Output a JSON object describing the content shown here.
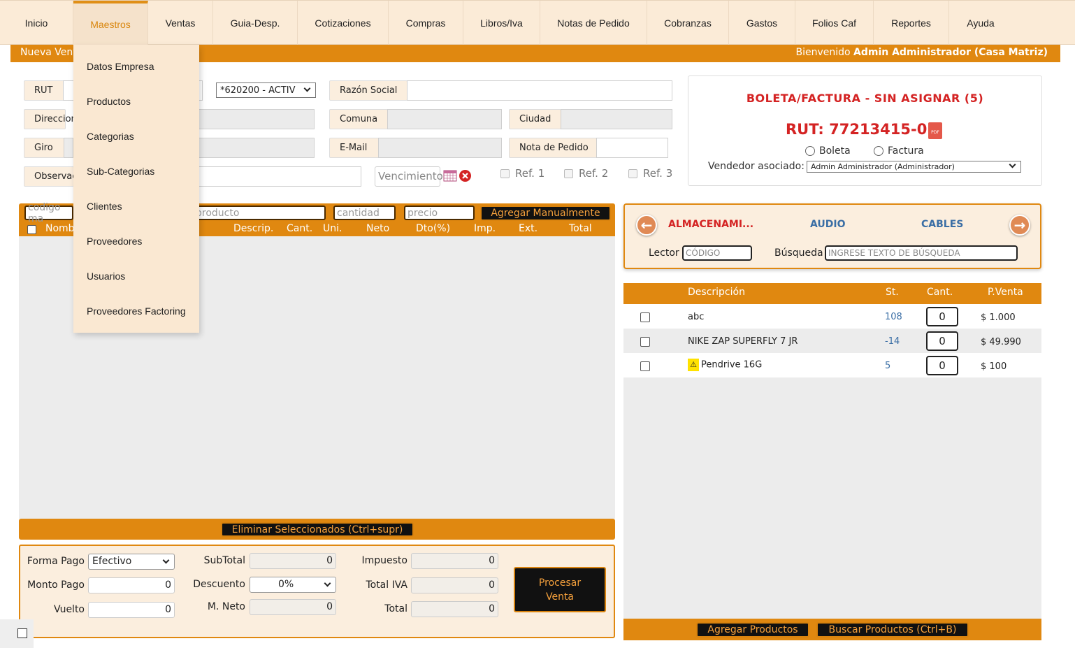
{
  "nav": {
    "items": [
      "Inicio",
      "Maestros",
      "Ventas",
      "Guia-Desp.",
      "Cotizaciones",
      "Compras",
      "Libros/Iva",
      "Notas de Pedido",
      "Cobranzas",
      "Gastos",
      "Folios Caf",
      "Reportes",
      "Ayuda"
    ],
    "active": "Maestros"
  },
  "welcome": {
    "left": "Nueva Vent",
    "prefix": "Bienvenido ",
    "user": "Admin Administrador (Casa Matriz)"
  },
  "dropdown": {
    "items": [
      "Datos Empresa",
      "Productos",
      "Categorias",
      "Sub-Categorias",
      "Clientes",
      "Proveedores",
      "Usuarios",
      "Proveedores Factoring"
    ]
  },
  "form": {
    "rut_label": "RUT",
    "activity_select": "*620200 - ACTIV",
    "razon_label": "Razón Social",
    "direccion_label": "Direccion",
    "comuna_label": "Comuna",
    "ciudad_label": "Ciudad",
    "giro_label": "Giro",
    "email_label": "E-Mail",
    "nota_label": "Nota de Pedido",
    "observ_label": "Observac",
    "vencimiento_placeholder": "Vencimiento",
    "refs": [
      "Ref. 1",
      "Ref. 2",
      "Ref. 3"
    ]
  },
  "docinfo": {
    "title": "BOLETA/FACTURA - SIN ASIGNAR (5)",
    "rut": "RUT: 77213415-0",
    "pdf_icon_text": "PDF",
    "radio_boleta": "Boleta",
    "radio_factura": "Factura",
    "vendedor_label": "Vendedor asociado:",
    "vendedor_value": "Admin Administrador (Administrador)"
  },
  "items": {
    "placeholder_codigo": "codigo ma",
    "placeholder_producto": "producto",
    "placeholder_cantidad": "cantidad",
    "placeholder_precio": "precio",
    "add_button": "Agregar Manualmente",
    "columns": [
      "Nomb",
      "Descrip.",
      "Cant.",
      "Uni.",
      "Neto",
      "Dto(%)",
      "Imp.",
      "Ext.",
      "Total"
    ],
    "delete_button": "Eliminar Seleccionados (Ctrl+supr)"
  },
  "totals": {
    "forma_pago_label": "Forma Pago",
    "forma_pago_value": "Efectivo",
    "monto_pago_label": "Monto Pago",
    "monto_pago_value": "0",
    "vuelto_label": "Vuelto",
    "vuelto_value": "0",
    "subtotal_label": "SubTotal",
    "subtotal_value": "0",
    "descuento_label": "Descuento",
    "descuento_value": "0%",
    "mneto_label": "M. Neto",
    "mneto_value": "0",
    "impuesto_label": "Impuesto",
    "impuesto_value": "0",
    "totaliva_label": "Total IVA",
    "totaliva_value": "0",
    "total_label": "Total",
    "total_value": "0",
    "process_line1": "Procesar",
    "process_line2": "Venta"
  },
  "categories": {
    "items": [
      "ALMACENAMI...",
      "AUDIO",
      "CABLES"
    ],
    "colors": [
      "#d42323",
      "#3a6ea5",
      "#3a6ea5"
    ],
    "lector_label": "Lector",
    "lector_placeholder": "CÓDIGO",
    "busqueda_label": "Búsqueda",
    "busqueda_placeholder": "INGRESE TEXTO DE BÚSQUEDA"
  },
  "products": {
    "columns": {
      "desc": "Descripción",
      "stock": "St.",
      "qty": "Cant.",
      "price": "P.Venta"
    },
    "rows": [
      {
        "desc": "abc",
        "stock": "108",
        "qty": "0",
        "price": "$ 1.000",
        "warn": false
      },
      {
        "desc": "NIKE ZAP SUPERFLY 7 JR",
        "stock": "-14",
        "qty": "0",
        "price": "$ 49.990",
        "warn": false
      },
      {
        "desc": "Pendrive 16G",
        "stock": "5",
        "qty": "0",
        "price": "$ 100",
        "warn": true
      }
    ],
    "add_button": "Agregar Productos",
    "search_button": "Buscar Productos (Ctrl+B)"
  },
  "colors": {
    "accent": "#e08810",
    "danger": "#d42323",
    "link": "#3a6ea5"
  }
}
